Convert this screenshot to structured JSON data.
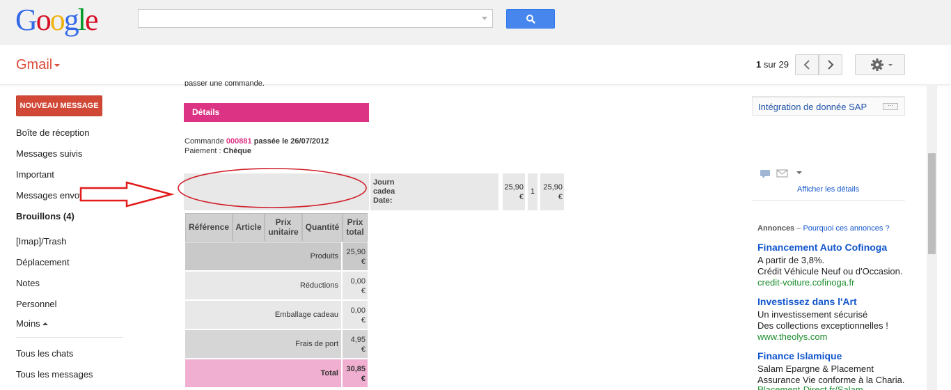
{
  "colors": {
    "brand_red": "#dd4b39",
    "accent_blue": "#4787ed",
    "pink": "#dd3385",
    "pink_light": "#f0afd0",
    "link": "#1155cc",
    "ad_green": "#1e8f2f"
  },
  "header": {
    "logo_letters": [
      {
        "ch": "G",
        "color": "#3369e8"
      },
      {
        "ch": "o",
        "color": "#d50f25"
      },
      {
        "ch": "o",
        "color": "#eeb211"
      },
      {
        "ch": "g",
        "color": "#3369e8"
      },
      {
        "ch": "l",
        "color": "#009925"
      },
      {
        "ch": "e",
        "color": "#d50f25"
      }
    ],
    "search_value": "",
    "search_icon": "search-icon"
  },
  "toolbar": {
    "app_label": "Gmail",
    "pager_current": "1",
    "pager_suffix": "sur 29",
    "prev_icon": "chevron-left-icon",
    "next_icon": "chevron-right-icon",
    "settings_icon": "gear-icon"
  },
  "sidebar": {
    "compose_label": "NOUVEAU MESSAGE",
    "items": [
      {
        "label": "Boîte de réception"
      },
      {
        "label": "Messages suivis"
      },
      {
        "label": "Important"
      },
      {
        "label": "Messages envoyés"
      },
      {
        "label": "Brouillons (4)"
      },
      {
        "label": "[Imap]/Trash"
      },
      {
        "label": "Déplacement"
      },
      {
        "label": "Notes"
      },
      {
        "label": "Personnel"
      },
      {
        "label": "Moins"
      },
      {
        "label": "Tous les chats"
      },
      {
        "label": "Tous les messages"
      }
    ]
  },
  "email": {
    "cut_text": "passer une commande.",
    "details_title": "Détails",
    "order_prefix": "Commande",
    "order_number": "000881",
    "order_suffix": "passée le 26/07/2012",
    "payment_prefix": "Paiement :",
    "payment_value": "Chèque",
    "first_row": {
      "journ_lines": [
        "Journ",
        "cadea",
        "Date:"
      ],
      "price": "25,90",
      "currency": "€",
      "qty": "1",
      "total": "25,90"
    },
    "table_headers": [
      "Référence",
      "Article",
      "Prix unitaire",
      "Quantité",
      "Prix total"
    ],
    "summary_rows": [
      {
        "label": "Produits",
        "value": "25,90"
      },
      {
        "label": "Réductions",
        "value": "0,00"
      },
      {
        "label": "Emballage cadeau",
        "value": "0,00"
      },
      {
        "label": "Frais de port",
        "value": "4,95"
      },
      {
        "label": "Total",
        "value": "30,85"
      }
    ]
  },
  "right_panel": {
    "sap_label": "Intégration de donnée SAP",
    "sap_more": "···",
    "show_details": "Afficher les détails",
    "ads_label": "Annonces",
    "ads_dash": "–",
    "ads_why": "Pourquoi ces annonces ?",
    "ads": [
      {
        "title": "Financement Auto Cofinoga",
        "lines": [
          "A partir de 3,8%.",
          "Crédit Véhicule Neuf ou d'Occasion."
        ],
        "url": "credit-voiture.cofinoga.fr"
      },
      {
        "title": "Investissez dans l'Art",
        "lines": [
          "Un investissement sécurisé",
          "Des collections exceptionnelles !"
        ],
        "url": "www.theolys.com"
      },
      {
        "title": "Finance Islamique",
        "lines": [
          "Salam Epargne & Placement",
          "Assurance Vie conforme à la Charia."
        ],
        "url": "Placement-Direct.fr/Salam"
      }
    ]
  }
}
